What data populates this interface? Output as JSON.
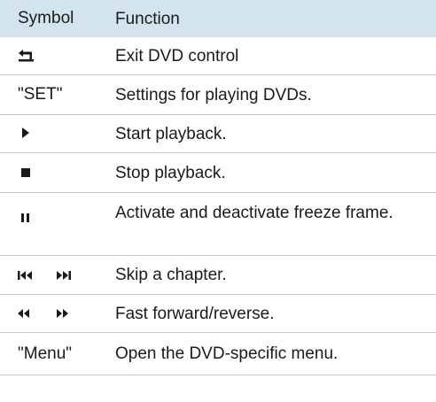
{
  "header": {
    "symbol_label": "Symbol",
    "function_label": "Function"
  },
  "rows": [
    {
      "symbol_icon": "exit-arrow-icon",
      "function": "Exit DVD control"
    },
    {
      "symbol_text": "\"SET\"",
      "function": "Settings for playing DVDs."
    },
    {
      "symbol_icon": "play-icon",
      "function": "Start playback."
    },
    {
      "symbol_icon": "stop-icon",
      "function": "Stop playback."
    },
    {
      "symbol_icon": "pause-icon",
      "function": "Activate and deactivate freeze frame."
    },
    {
      "symbol_icons": [
        "skip-back-icon",
        "skip-forward-icon"
      ],
      "function": "Skip a chapter."
    },
    {
      "symbol_icons": [
        "rewind-icon",
        "fast-forward-icon"
      ],
      "function": "Fast forward/reverse."
    },
    {
      "symbol_text": "\"Menu\"",
      "function": "Open the DVD-specific menu."
    }
  ],
  "colors": {
    "header_bg": "#d3e4ee",
    "divider": "#c9c9c9",
    "text": "#1a1a1a"
  }
}
